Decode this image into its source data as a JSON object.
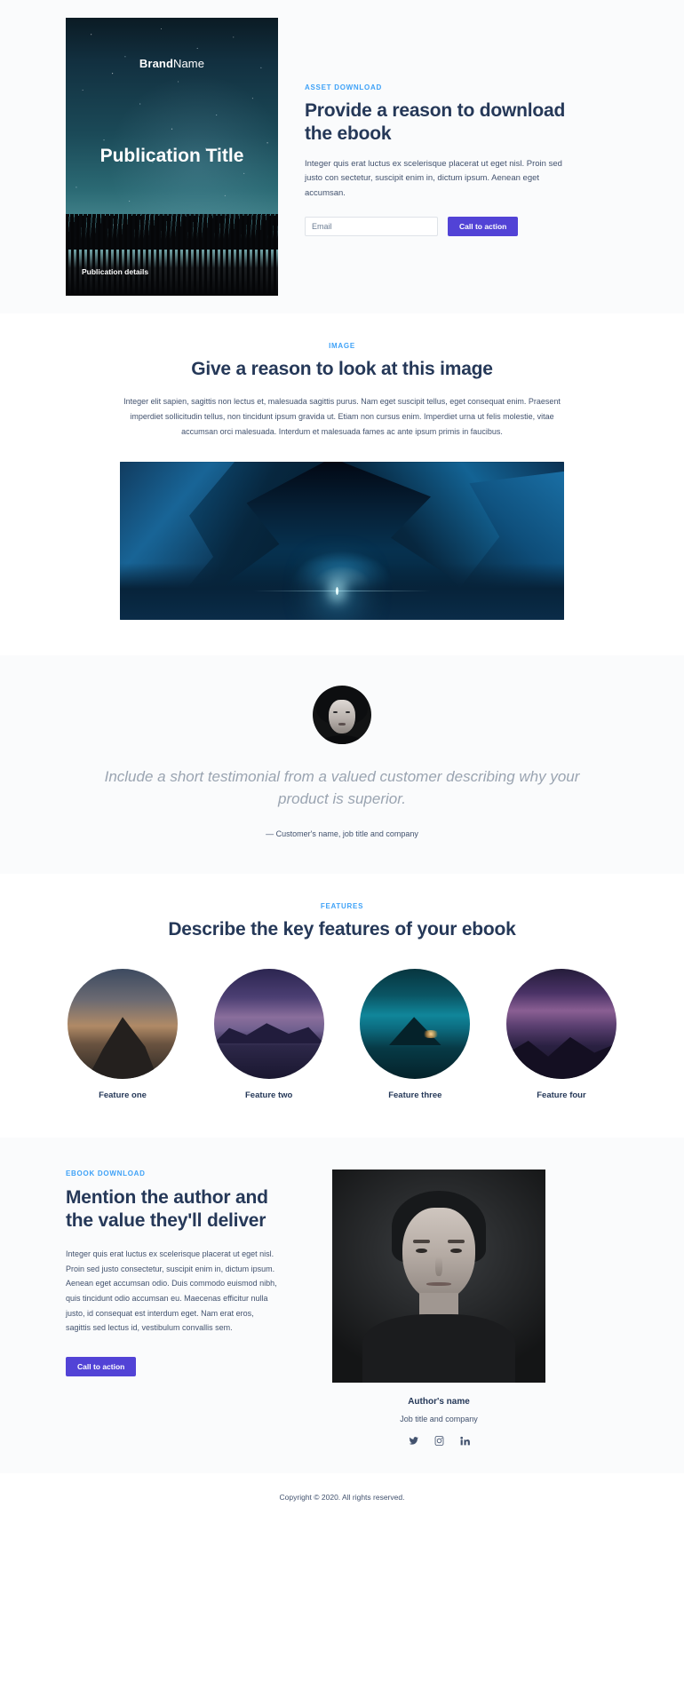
{
  "hero": {
    "cover": {
      "brand_bold": "Brand",
      "brand_light": "Name",
      "publication_title": "Publication Title",
      "publication_details": "Publication details"
    },
    "eyebrow": "ASSET DOWNLOAD",
    "heading": "Provide a reason to download the ebook",
    "body": "Integer quis erat luctus ex scelerisque placerat ut eget nisl. Proin sed justo con sectetur, suscipit enim in, dictum ipsum. Aenean eget accumsan.",
    "email_placeholder": "Email",
    "email_value": "",
    "cta_label": "Call to action",
    "cta_color": "#5243d6",
    "eyebrow_color": "#3fa2f7",
    "heading_color": "#253858",
    "background": "#fafbfc"
  },
  "image_section": {
    "eyebrow": "IMAGE",
    "heading": "Give a reason to look at this image",
    "body": "Integer elit sapien, sagittis non lectus et, malesuada sagittis purus. Nam eget suscipit tellus, eget consequat enim. Praesent imperdiet sollicitudin tellus, non tincidunt ipsum gravida ut. Etiam non cursus enim. Imperdiet urna ut felis molestie, vitae accumsan orci malesuada. Interdum et malesuada fames ac ante ipsum primis in faucibus.",
    "image_alt": "night-mountain-canyon-photo"
  },
  "testimonial": {
    "avatar_alt": "customer-avatar",
    "quote": "Include a short testimonial from a valued customer describing why your product is superior.",
    "attribution": "— Customer's name, job title and company",
    "background": "#fafbfc"
  },
  "features": {
    "eyebrow": "FEATURES",
    "heading": "Describe the key features of your ebook",
    "items": [
      {
        "label": "Feature one",
        "image_alt": "mountain-peak-dusk"
      },
      {
        "label": "Feature two",
        "image_alt": "purple-lake-twilight"
      },
      {
        "label": "Feature three",
        "image_alt": "teal-sunset-island"
      },
      {
        "label": "Feature four",
        "image_alt": "milky-way-mountains"
      }
    ]
  },
  "author_section": {
    "eyebrow": "EBOOK DOWNLOAD",
    "heading": "Mention the author and the value they'll deliver",
    "body": "Integer quis erat luctus ex scelerisque placerat ut eget nisl. Proin sed justo consectetur, suscipit enim in, dictum ipsum. Aenean eget accumsan odio. Duis commodo euismod nibh, quis tincidunt odio accumsan eu. Maecenas efficitur nulla justo, id consequat est interdum eget. Nam erat eros, sagittis sed lectus id, vestibulum convallis sem.",
    "cta_label": "Call to action",
    "author_photo_alt": "author-portrait",
    "author_name": "Author's name",
    "author_job": "Job title and company",
    "socials": [
      {
        "name": "twitter-icon"
      },
      {
        "name": "instagram-icon"
      },
      {
        "name": "linkedin-icon"
      }
    ]
  },
  "footer": {
    "copyright": "Copyright © 2020. All rights reserved."
  }
}
